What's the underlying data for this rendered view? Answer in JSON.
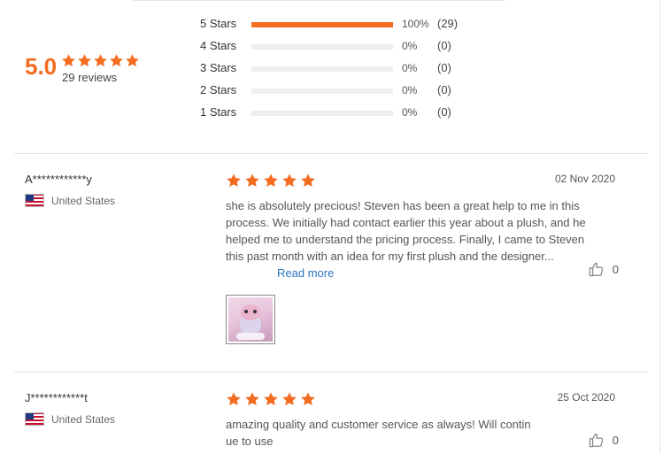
{
  "summary": {
    "score": "5.0",
    "reviews_label": "29 reviews",
    "rating": 5,
    "accent_color": "#f36c21"
  },
  "distribution": [
    {
      "label": "5 Stars",
      "percent": "100%",
      "count": "(29)",
      "fraction": 1.0
    },
    {
      "label": "4 Stars",
      "percent": "0%",
      "count": "(0)",
      "fraction": 0
    },
    {
      "label": "3 Stars",
      "percent": "0%",
      "count": "(0)",
      "fraction": 0
    },
    {
      "label": "2 Stars",
      "percent": "0%",
      "count": "(0)",
      "fraction": 0
    },
    {
      "label": "1 Stars",
      "percent": "0%",
      "count": "(0)",
      "fraction": 0
    }
  ],
  "reviews": [
    {
      "reviewer": "A************y",
      "country": "United States",
      "flag_icon": "us-flag-icon",
      "rating": 5,
      "date": "02 Nov 2020",
      "text": "she is absolutely precious! Steven has been a great help to me in this process. We initially had contact earlier this year about a plush, and he helped me to understand the pricing process. Finally, I came to Steven this past month with an idea for my first plush and the designer...",
      "read_more": "Read more",
      "likes": "0",
      "has_photo": true
    },
    {
      "reviewer": "J************t",
      "country": "United States",
      "flag_icon": "us-flag-icon",
      "rating": 5,
      "date": "25 Oct 2020",
      "text": "amazing quality and customer service as always! Will continue to use",
      "likes": "0",
      "has_photo": false
    }
  ]
}
